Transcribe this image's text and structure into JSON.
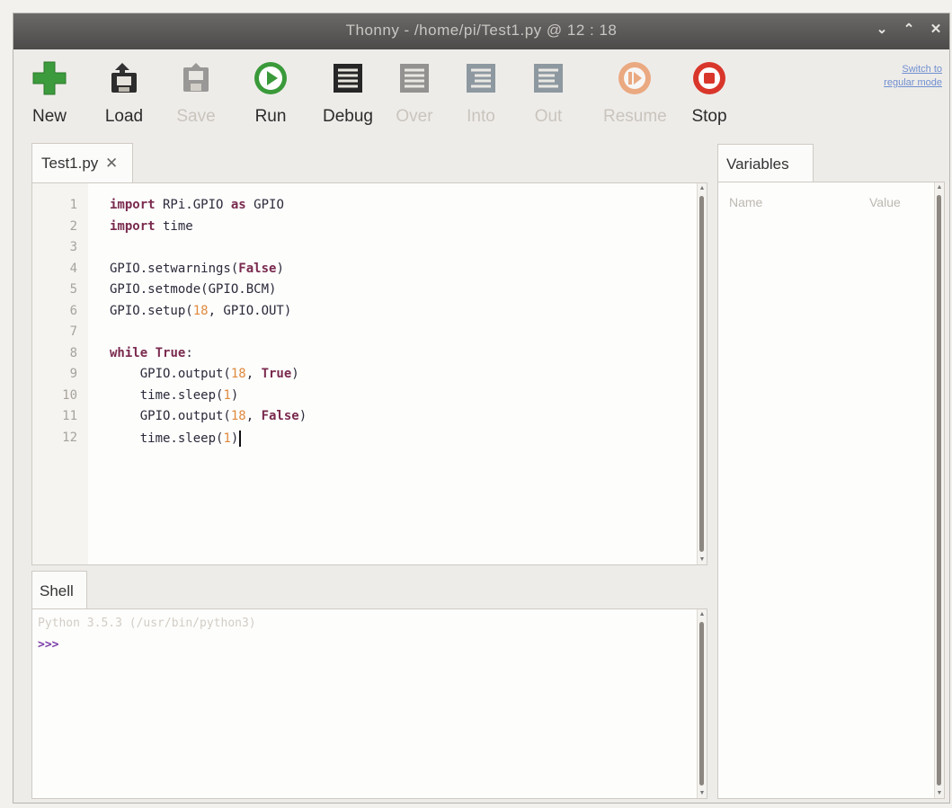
{
  "window": {
    "title": "Thonny  -  /home/pi/Test1.py  @  12 : 18",
    "controls": [
      "⌄",
      "⌃",
      "✕"
    ]
  },
  "toolbar": {
    "buttons": [
      {
        "label": "New",
        "icon": "plus-icon",
        "enabled": true
      },
      {
        "label": "Load",
        "icon": "folder-open-icon",
        "enabled": true
      },
      {
        "label": "Save",
        "icon": "save-icon",
        "enabled": false
      },
      {
        "label": "Run",
        "icon": "play-icon",
        "enabled": true
      },
      {
        "label": "Debug",
        "icon": "debug-icon",
        "enabled": true
      },
      {
        "label": "Over",
        "icon": "step-over-icon",
        "enabled": false
      },
      {
        "label": "Into",
        "icon": "step-into-icon",
        "enabled": false
      },
      {
        "label": "Out",
        "icon": "step-out-icon",
        "enabled": false
      },
      {
        "label": "Resume",
        "icon": "resume-icon",
        "enabled": false
      },
      {
        "label": "Stop",
        "icon": "stop-icon",
        "enabled": true
      }
    ],
    "switch_mode_line1": "Switch to",
    "switch_mode_line2": "regular mode"
  },
  "editor": {
    "tab_label": "Test1.py",
    "tab_close": "✕",
    "lines": [
      {
        "n": "1",
        "tokens": [
          {
            "t": "import",
            "c": "kw"
          },
          {
            "t": " RPi.GPIO ",
            "c": ""
          },
          {
            "t": "as",
            "c": "kw"
          },
          {
            "t": " GPIO",
            "c": ""
          }
        ]
      },
      {
        "n": "2",
        "tokens": [
          {
            "t": "import",
            "c": "kw"
          },
          {
            "t": " time",
            "c": ""
          }
        ]
      },
      {
        "n": "3",
        "tokens": []
      },
      {
        "n": "4",
        "tokens": [
          {
            "t": "GPIO.setwarnings(",
            "c": ""
          },
          {
            "t": "False",
            "c": "kw"
          },
          {
            "t": ")",
            "c": ""
          }
        ]
      },
      {
        "n": "5",
        "tokens": [
          {
            "t": "GPIO.setmode(GPIO.BCM)",
            "c": ""
          }
        ]
      },
      {
        "n": "6",
        "tokens": [
          {
            "t": "GPIO.setup(",
            "c": ""
          },
          {
            "t": "18",
            "c": "num"
          },
          {
            "t": ", GPIO.OUT)",
            "c": ""
          }
        ]
      },
      {
        "n": "7",
        "tokens": []
      },
      {
        "n": "8",
        "tokens": [
          {
            "t": "while",
            "c": "kw"
          },
          {
            "t": " ",
            "c": ""
          },
          {
            "t": "True",
            "c": "kw"
          },
          {
            "t": ":",
            "c": ""
          }
        ]
      },
      {
        "n": "9",
        "tokens": [
          {
            "t": "    GPIO.output(",
            "c": ""
          },
          {
            "t": "18",
            "c": "num"
          },
          {
            "t": ", ",
            "c": ""
          },
          {
            "t": "True",
            "c": "kw"
          },
          {
            "t": ")",
            "c": ""
          }
        ]
      },
      {
        "n": "10",
        "tokens": [
          {
            "t": "    time.sleep(",
            "c": ""
          },
          {
            "t": "1",
            "c": "num"
          },
          {
            "t": ")",
            "c": ""
          }
        ]
      },
      {
        "n": "11",
        "tokens": [
          {
            "t": "    GPIO.output(",
            "c": ""
          },
          {
            "t": "18",
            "c": "num"
          },
          {
            "t": ", ",
            "c": ""
          },
          {
            "t": "False",
            "c": "kw"
          },
          {
            "t": ")",
            "c": ""
          }
        ]
      },
      {
        "n": "12",
        "tokens": [
          {
            "t": "    time.sleep(",
            "c": ""
          },
          {
            "t": "1",
            "c": "num"
          },
          {
            "t": ")",
            "c": ""
          }
        ],
        "caret": true
      }
    ]
  },
  "shell": {
    "tab_label": "Shell",
    "banner": "Python 3.5.3 (/usr/bin/python3)",
    "prompt": ">>>"
  },
  "variables": {
    "tab_label": "Variables",
    "col_name": "Name",
    "col_value": "Value"
  },
  "colors": {
    "keyword": "#7a2a4e",
    "number": "#e08a3e",
    "prompt": "#7b3fa8",
    "run_green": "#3a9a3a",
    "stop_red": "#d9362b",
    "new_green": "#3c9b3c"
  }
}
